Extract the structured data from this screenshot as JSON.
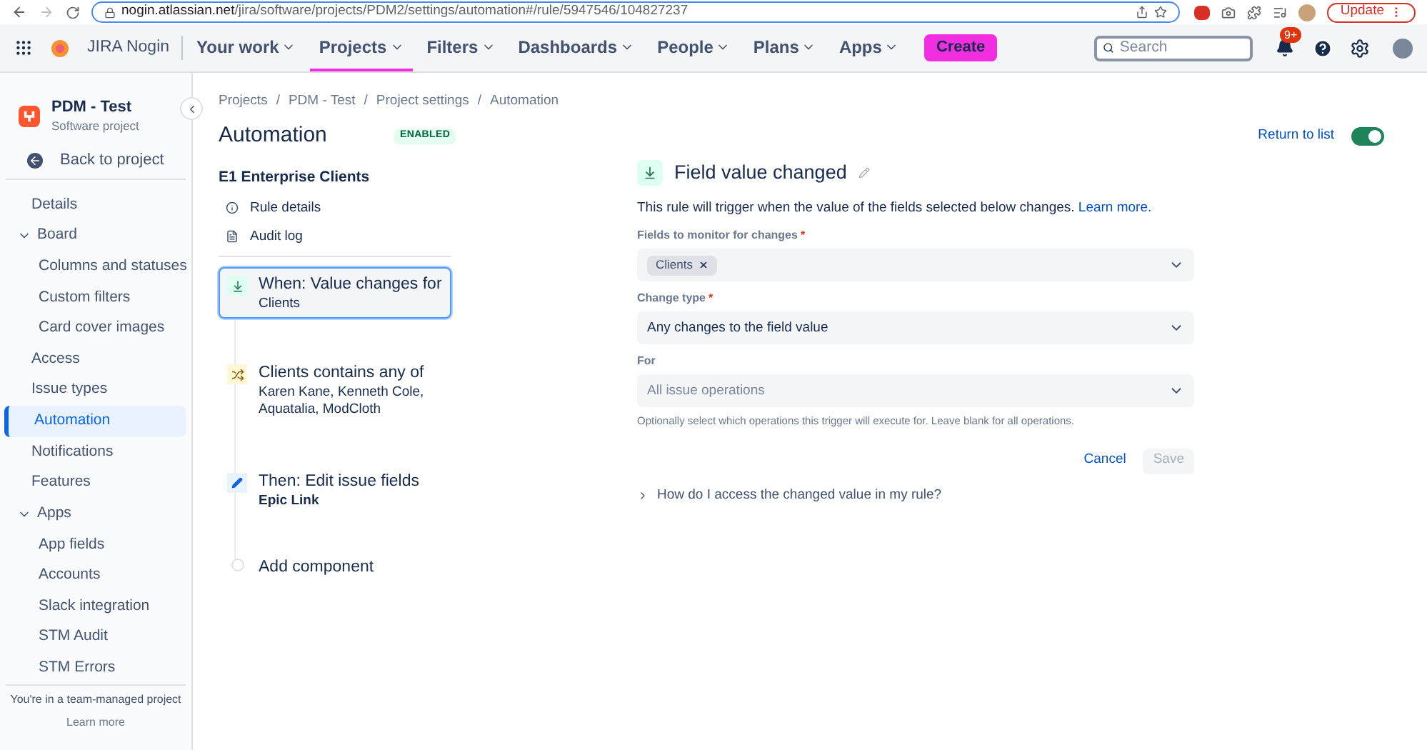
{
  "browser": {
    "url_host": "nogin.atlassian.net",
    "url_path": "/jira/software/projects/PDM2/settings/automation#/rule/5947546/104827237",
    "update_label": "Update"
  },
  "nav": {
    "site": "JIRA Nogin",
    "items": [
      {
        "label": "Your work",
        "selected": false
      },
      {
        "label": "Projects",
        "selected": true
      },
      {
        "label": "Filters",
        "selected": false
      },
      {
        "label": "Dashboards",
        "selected": false
      },
      {
        "label": "People",
        "selected": false
      },
      {
        "label": "Plans",
        "selected": false
      },
      {
        "label": "Apps",
        "selected": false
      }
    ],
    "create": "Create",
    "search_placeholder": "Search",
    "notification_badge": "9+"
  },
  "sidebar": {
    "project_name": "PDM - Test",
    "project_type": "Software project",
    "back": "Back to project",
    "items": [
      {
        "label": "Details",
        "selected": false
      },
      {
        "label": "Board",
        "selected": false,
        "expanded": true,
        "children": [
          {
            "label": "Columns and statuses",
            "selected": false
          },
          {
            "label": "Custom filters",
            "selected": false
          },
          {
            "label": "Card cover images",
            "selected": false
          }
        ]
      },
      {
        "label": "Access",
        "selected": false
      },
      {
        "label": "Issue types",
        "selected": false
      },
      {
        "label": "Automation",
        "selected": true
      },
      {
        "label": "Notifications",
        "selected": false
      },
      {
        "label": "Features",
        "selected": false
      },
      {
        "label": "Apps",
        "selected": false,
        "expanded": true,
        "children": [
          {
            "label": "App fields",
            "selected": false
          },
          {
            "label": "Accounts",
            "selected": false
          },
          {
            "label": "Slack integration",
            "selected": false
          },
          {
            "label": "STM Audit",
            "selected": false
          },
          {
            "label": "STM Errors",
            "selected": false
          }
        ]
      }
    ],
    "footer": "You're in a team-managed project",
    "footer_link": "Learn more"
  },
  "breadcrumbs": [
    "Projects",
    "PDM - Test",
    "Project settings",
    "Automation"
  ],
  "breadcrumb_separator": "/",
  "page": {
    "title": "Automation",
    "status": "ENABLED",
    "return_link": "Return to list",
    "enabled": true
  },
  "rule": {
    "name": "E1 Enterprise Clients",
    "links": [
      "Rule details",
      "Audit log"
    ],
    "components": [
      {
        "kind": "trigger",
        "title": "When: Value changes for",
        "detail": "Clients",
        "selected": true
      },
      {
        "kind": "condition",
        "title": "Clients contains any of",
        "detail": "Karen Kane, Kenneth Cole, Aquatalia, ModCloth",
        "selected": false
      },
      {
        "kind": "action",
        "title": "Then: Edit issue fields",
        "detail": "Epic Link",
        "selected": false
      },
      {
        "kind": "add",
        "title": "Add component",
        "selected": false
      }
    ]
  },
  "editor": {
    "required_mark": "*",
    "title": "Field value changed",
    "description": "This rule will trigger when the value of the fields selected below changes.",
    "learn_more": "Learn more.",
    "fields": [
      {
        "label": "Fields to monitor for changes",
        "required": true,
        "tags": [
          "Clients"
        ]
      },
      {
        "label": "Change type",
        "required": true,
        "value": "Any changes to the field value"
      },
      {
        "label": "For",
        "required": false,
        "placeholder": "All issue operations",
        "help": "Optionally select which operations this trigger will execute for. Leave blank for all operations."
      }
    ],
    "cancel": "Cancel",
    "save": "Save",
    "save_disabled": true,
    "faq": "How do I access the changed value in my rule?",
    "faq_expanded": false
  }
}
